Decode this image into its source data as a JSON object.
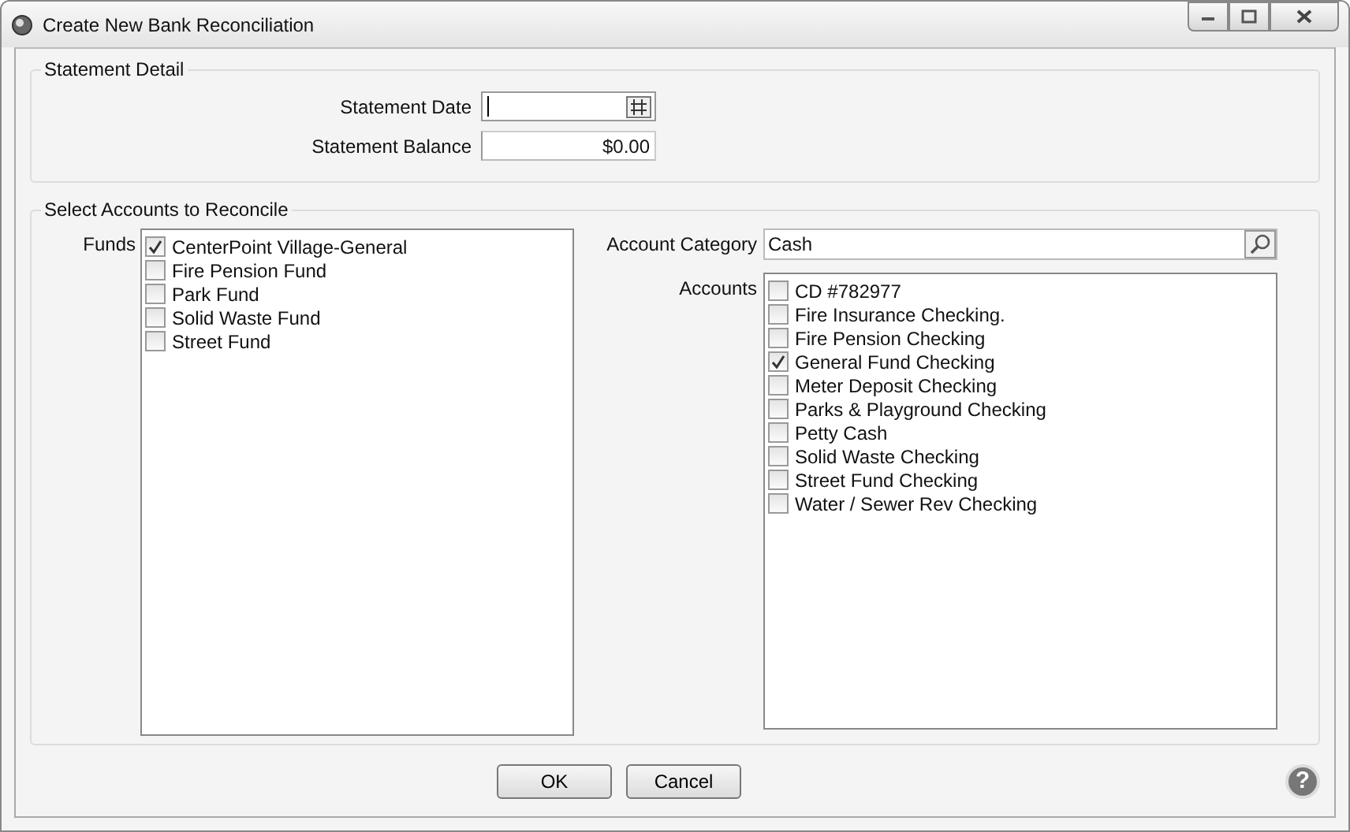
{
  "window": {
    "title": "Create New Bank Reconciliation"
  },
  "statement_detail": {
    "title": "Statement Detail",
    "date_label": "Statement Date",
    "balance_label": "Statement Balance",
    "balance_value": "$0.00"
  },
  "select_accounts": {
    "title": "Select Accounts to Reconcile",
    "funds_label": "Funds",
    "funds": [
      {
        "label": "CenterPoint Village-General",
        "checked": true
      },
      {
        "label": "Fire Pension Fund",
        "checked": false
      },
      {
        "label": "Park Fund",
        "checked": false
      },
      {
        "label": "Solid Waste Fund",
        "checked": false
      },
      {
        "label": "Street Fund",
        "checked": false
      }
    ],
    "category_label": "Account Category",
    "category_value": "Cash",
    "accounts_label": "Accounts",
    "accounts": [
      {
        "label": "CD #782977",
        "checked": false
      },
      {
        "label": "Fire Insurance Checking.",
        "checked": false
      },
      {
        "label": "Fire Pension Checking",
        "checked": false
      },
      {
        "label": "General Fund Checking",
        "checked": true
      },
      {
        "label": "Meter Deposit Checking",
        "checked": false
      },
      {
        "label": "Parks & Playground Checking",
        "checked": false
      },
      {
        "label": "Petty Cash",
        "checked": false
      },
      {
        "label": "Solid Waste Checking",
        "checked": false
      },
      {
        "label": "Street Fund Checking",
        "checked": false
      },
      {
        "label": "Water / Sewer Rev Checking",
        "checked": false
      }
    ]
  },
  "buttons": [
    "OK",
    "Cancel"
  ],
  "help": "?"
}
